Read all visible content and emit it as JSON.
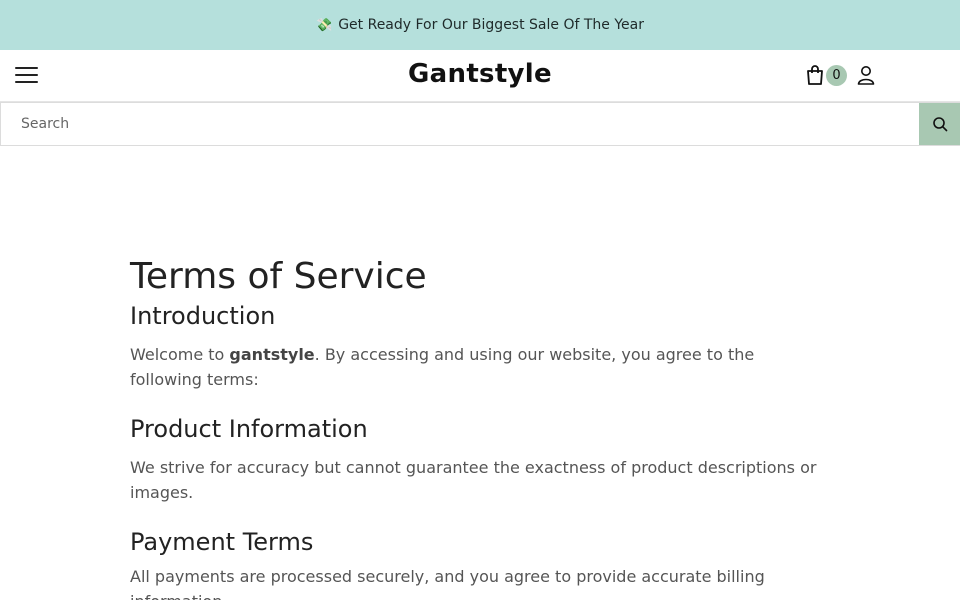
{
  "announcement": {
    "icon": "money-icon",
    "text": "Get Ready For Our Biggest Sale Of The Year"
  },
  "header": {
    "logo": "Gantstyle",
    "cart_count": "0"
  },
  "search": {
    "placeholder": "Search"
  },
  "page": {
    "title": "Terms of Service",
    "sections": [
      {
        "heading": "Introduction",
        "text_before": "Welcome to ",
        "text_bold": "gantstyle",
        "text_after": ". By accessing and using our website, you agree to the following terms:"
      },
      {
        "heading": "Product Information",
        "text": "We strive for accuracy but cannot guarantee the exactness of product descriptions or images."
      },
      {
        "heading": "Payment Terms",
        "text": "All payments are processed securely, and you agree to provide accurate billing information."
      }
    ]
  },
  "colors": {
    "announcement_bg": "#b5e0dc",
    "accent": "#a8c8b2"
  }
}
